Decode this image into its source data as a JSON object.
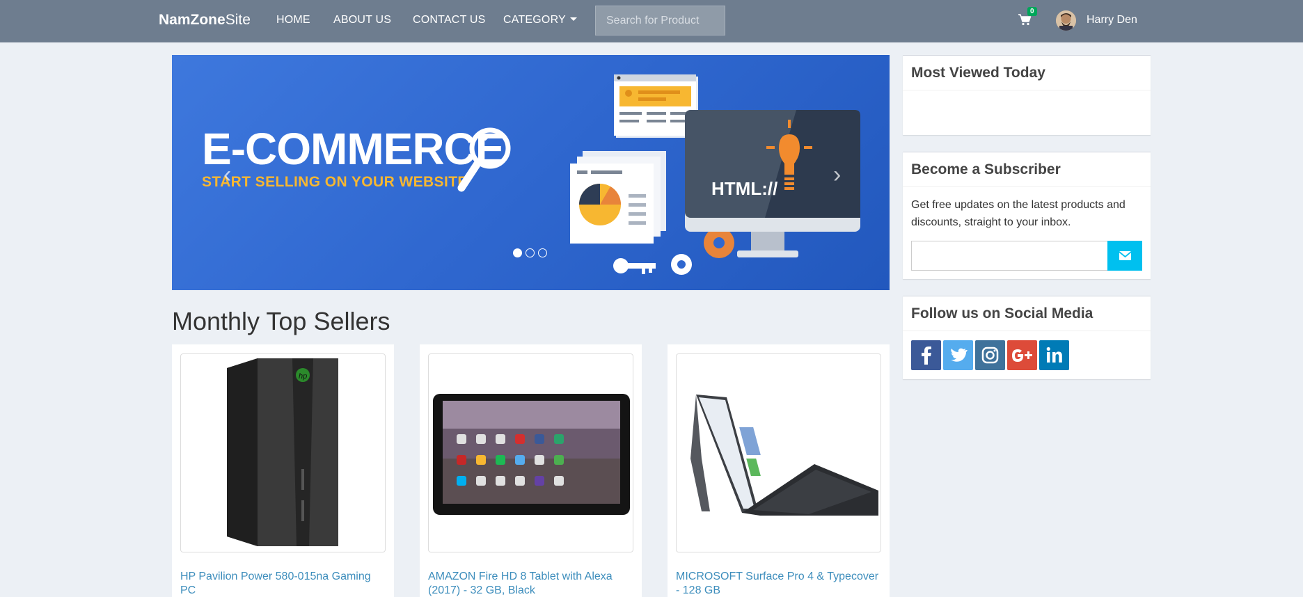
{
  "navbar": {
    "brand_bold": "NamZone",
    "brand_light": "Site",
    "links": [
      "HOME",
      "ABOUT US",
      "CONTACT US",
      "CATEGORY"
    ],
    "search_placeholder": "Search for Product",
    "cart_count": "0",
    "user_name": "Harry Den"
  },
  "hero": {
    "title": "E-COMMERCE",
    "subtitle": "START SELLING ON YOUR WEBSITE",
    "screen_text": "HTML://",
    "slide_count": 3,
    "active_slide": 1
  },
  "section": {
    "title": "Monthly Top Sellers"
  },
  "products": [
    {
      "name": "HP Pavilion Power 580-015na Gaming PC"
    },
    {
      "name": "AMAZON Fire HD 8 Tablet with Alexa (2017) - 32 GB, Black"
    },
    {
      "name": "MICROSOFT Surface Pro 4 & Typecover - 128 GB"
    }
  ],
  "sidebar": {
    "most_viewed_title": "Most Viewed Today",
    "subscribe_title": "Become a Subscriber",
    "subscribe_text": "Get free updates on the latest products and discounts, straight to your inbox.",
    "social_title": "Follow us on Social Media",
    "social_icons": [
      "facebook-icon",
      "twitter-icon",
      "instagram-icon",
      "google-plus-icon",
      "linkedin-icon"
    ]
  },
  "colors": {
    "navbar": "#6e7d8f",
    "hero_blue": "#3e78dd",
    "link": "#3c8dbc",
    "subscribe_button": "#00c0ef",
    "facebook": "#3b5998",
    "twitter": "#55acee",
    "instagram": "#3f729b",
    "google_plus": "#dd4b39",
    "linkedin": "#007bb6"
  }
}
